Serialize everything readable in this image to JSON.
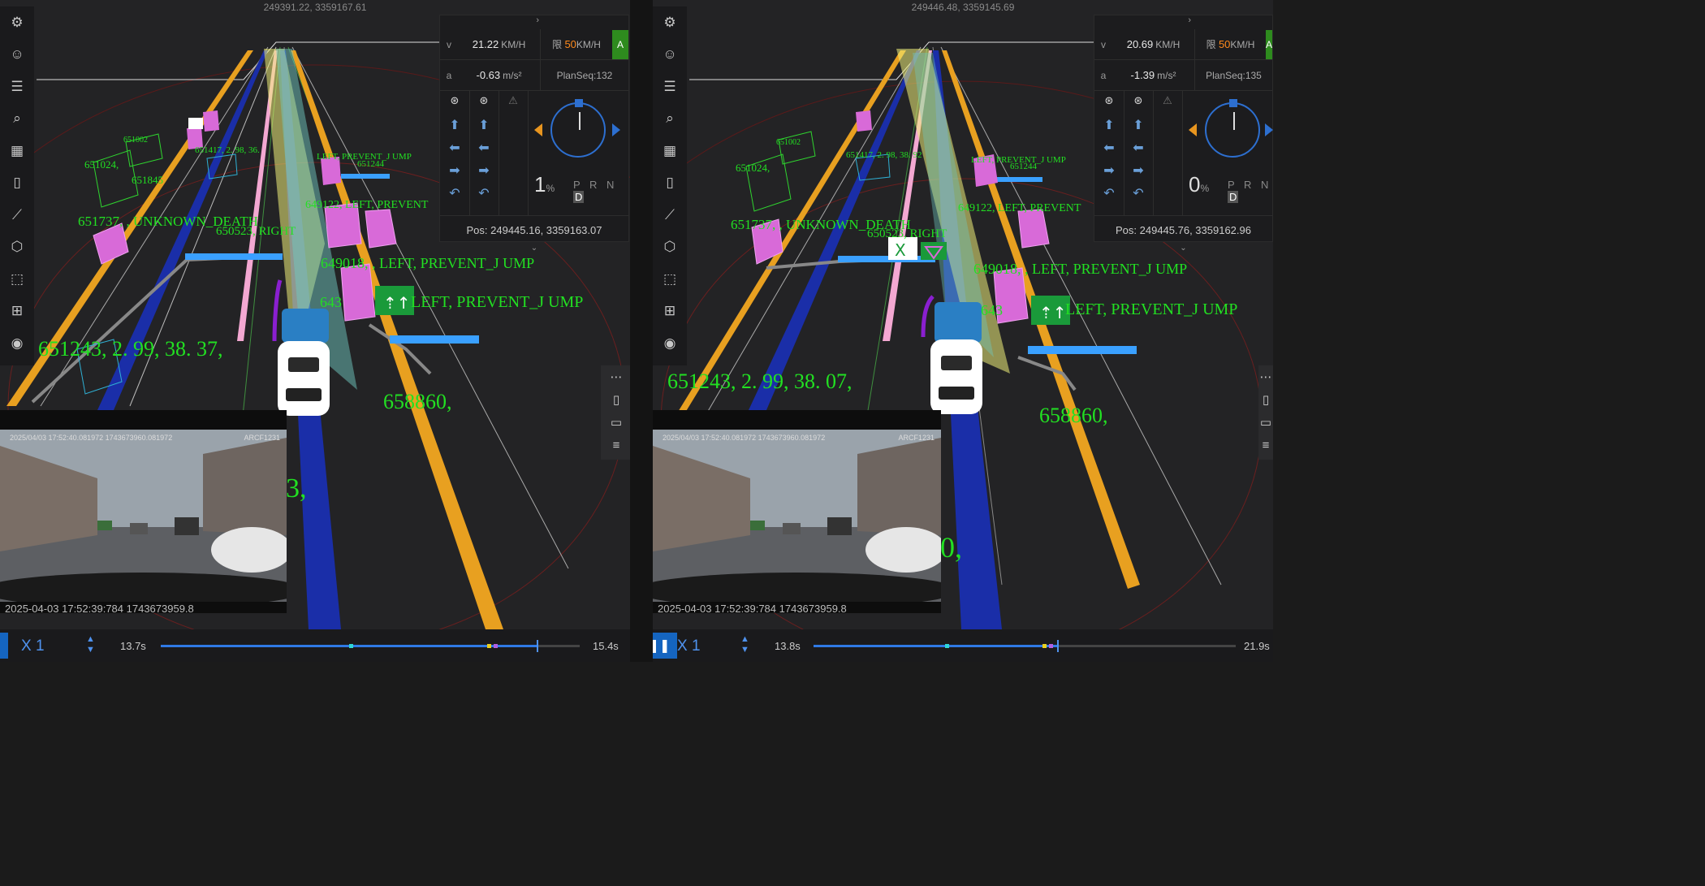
{
  "left": {
    "coord_header": "249391.22, 3359167.61",
    "panel": {
      "v_label": "v",
      "v_value": "21.22",
      "v_unit": "KM/H",
      "limit_prefix": "限",
      "limit_value": "50",
      "limit_unit": "KM/H",
      "mode_badge": "A",
      "a_label": "a",
      "a_value": "-0.63",
      "a_unit": "m/s²",
      "plan_seq": "PlanSeq:132",
      "throttle_value": "1",
      "throttle_unit": "%",
      "gears": "P R N",
      "gear_active": "D",
      "pos": "Pos: 249445.16, 3359163.07"
    },
    "overlay_labels": {
      "big1": "651243, 2. 99, 38. 37,",
      "big2": "658860,",
      "big3": "3,",
      "obj1": "651737, , UNKNOWN_DEATH",
      "obj2": "649018, , LEFT, PREVENT_J UMP",
      "obj3": "LEFT, PREVENT_J UMP",
      "obj4": "649122, LEFT, PREVENT",
      "obj5": "651024,",
      "obj6": "651845",
      "obj7": "651002",
      "obj8": "651417, 2. 98, 36.",
      "obj9": "651244",
      "obj10": "650523, RIGHT",
      "obj11": "LEFT, PREVENT_J UMP",
      "obj12": "643"
    },
    "camera": {
      "timestamp": "2025/04/03 17:52:40.081972 1743673960.081972",
      "device": "ARCF1231",
      "caption": "2025-04-03 17:52:39:784 1743673959.8"
    },
    "playback": {
      "speed": "X 1",
      "current_time": "13.7s",
      "end_time": "15.4s",
      "progress": 0.897
    }
  },
  "right": {
    "coord_header": "249446.48, 3359145.69",
    "panel": {
      "v_label": "v",
      "v_value": "20.69",
      "v_unit": "KM/H",
      "limit_prefix": "限",
      "limit_value": "50",
      "limit_unit": "KM/H",
      "mode_badge": "A",
      "a_label": "a",
      "a_value": "-1.39",
      "a_unit": "m/s²",
      "plan_seq": "PlanSeq:135",
      "throttle_value": "0",
      "throttle_unit": "%",
      "gears": "P R N",
      "gear_active": "D",
      "pos": "Pos: 249445.76, 3359162.96"
    },
    "overlay_labels": {
      "big1": "651243, 2. 99, 38. 07,",
      "big2": "658860,",
      "big3": "0,",
      "obj1": "651737, , UNKNOWN_DEATH",
      "obj2": "649018, , LEFT, PREVENT_J UMP",
      "obj3": "LEFT, PREVENT_J UMP",
      "obj4": "649122, LEFT, PREVENT",
      "obj5": "651024,",
      "obj7": "651002",
      "obj8": "651417, 2. 98, 38. 92",
      "obj9": "651244",
      "obj10": "650523, RIGHT",
      "obj11": "LEFT, PREVENT_J UMP",
      "obj12": "643"
    },
    "camera": {
      "timestamp": "2025/04/03 17:52:40.081972 1743673960.081972",
      "device": "ARCF1231",
      "caption": "2025-04-03 17:52:39:784 1743673959.8"
    },
    "playback": {
      "speed": "X 1",
      "current_time": "13.8s",
      "end_time": "21.9s",
      "progress": 0.577
    }
  },
  "toolbar_icons": [
    "gear-icon",
    "smiley-icon",
    "sliders-icon",
    "search-icon",
    "layers-icon",
    "bookmark-icon",
    "ruler-icon",
    "cube-icon",
    "bounding-box-icon",
    "grid-icon",
    "camera-icon"
  ],
  "side_icons": [
    "drag-handle-icon",
    "book-icon",
    "comment-icon",
    "list-icon"
  ],
  "colors": {
    "accent_blue": "#2f7ae5",
    "label_green": "#22e022",
    "lane_orange": "#e8a020",
    "lane_blue": "#1a2ea8",
    "obstacle_magenta": "#d86ad8",
    "badge_green": "#2e8b1e",
    "limit_orange": "#ff8a1c"
  }
}
